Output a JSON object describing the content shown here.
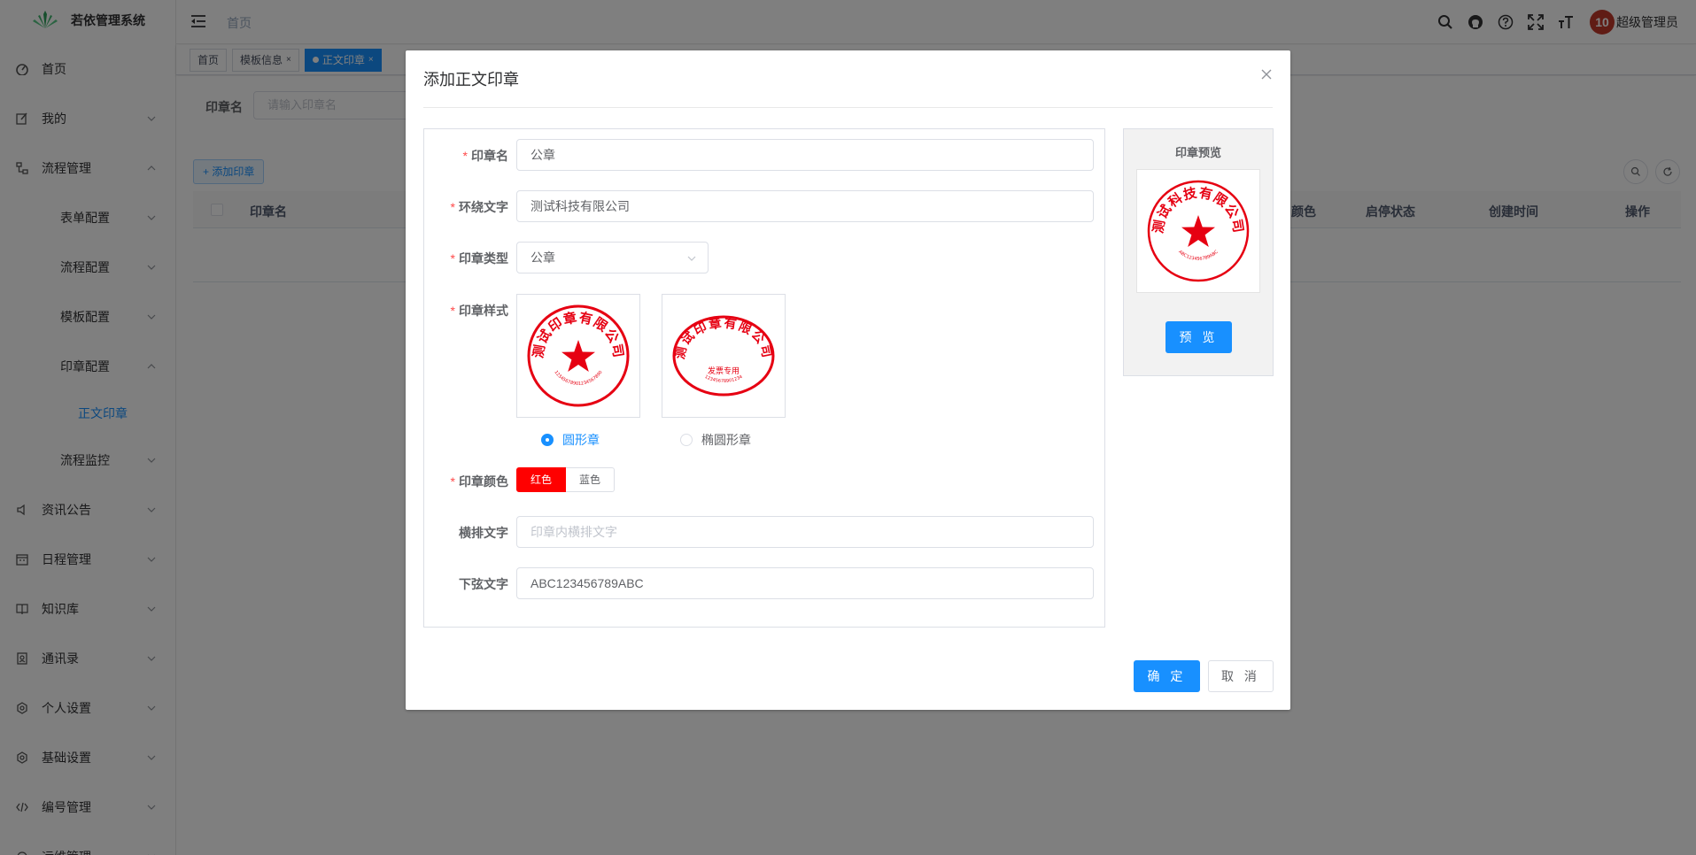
{
  "app": {
    "title": "若依管理系统"
  },
  "sidebar": {
    "items": [
      {
        "label": "首页",
        "icon": "dashboard-icon"
      },
      {
        "label": "我的",
        "icon": "edit-icon"
      },
      {
        "label": "流程管理",
        "icon": "flow-icon"
      },
      {
        "label": "表单配置"
      },
      {
        "label": "流程配置"
      },
      {
        "label": "模板配置"
      },
      {
        "label": "印章配置"
      },
      {
        "label": "正文印章"
      },
      {
        "label": "流程监控"
      },
      {
        "label": "资讯公告",
        "icon": "sound-icon"
      },
      {
        "label": "日程管理",
        "icon": "calendar-icon"
      },
      {
        "label": "知识库",
        "icon": "book-icon"
      },
      {
        "label": "通讯录",
        "icon": "contacts-icon"
      },
      {
        "label": "个人设置",
        "icon": "settings-icon"
      },
      {
        "label": "基础设置",
        "icon": "settings-icon"
      },
      {
        "label": "编号管理",
        "icon": "code-icon"
      },
      {
        "label": "运维管理",
        "icon": "tool-icon"
      }
    ]
  },
  "navbar": {
    "breadcrumb": "首页",
    "avatar_text": "10",
    "username": "超级管理员"
  },
  "tags": [
    {
      "label": "首页"
    },
    {
      "label": "模板信息"
    },
    {
      "label": "正文印章"
    }
  ],
  "page": {
    "search_label": "印章名",
    "search_placeholder": "请输入印章名",
    "add_button": "添加印章",
    "columns": [
      "印章名",
      "颜色",
      "启停状态",
      "创建时间",
      "操作"
    ]
  },
  "dialog": {
    "title": "添加正文印章",
    "fields": {
      "name": {
        "label": "印章名",
        "value": "公章"
      },
      "surround": {
        "label": "环绕文字",
        "value": "测试科技有限公司"
      },
      "type": {
        "label": "印章类型",
        "value": "公章"
      },
      "style": {
        "label": "印章样式"
      },
      "color": {
        "label": "印章颜色"
      },
      "horizontal": {
        "label": "横排文字",
        "placeholder": "印章内横排文字"
      },
      "bottom": {
        "label": "下弦文字",
        "value": "ABC123456789ABC"
      }
    },
    "styles": [
      {
        "label": "圆形章",
        "checked": true,
        "image_text": "测试印章有限公司",
        "image_number": "12345678901234567890"
      },
      {
        "label": "椭圆形章",
        "checked": false,
        "image_text": "测试印章有限公司",
        "image_inner": "发票专用",
        "image_number": "12345678901234"
      }
    ],
    "colors": [
      "红色",
      "蓝色"
    ],
    "selected_color": "红色",
    "preview": {
      "title": "印章预览",
      "button": "预 览",
      "seal_text": "测试科技有限公司",
      "seal_bottom": "ABC123456789ABC"
    },
    "ok": "确 定",
    "cancel": "取 消"
  },
  "theme": {
    "primary": "#1890ff",
    "seal_red": "#ff0000",
    "overlay": "rgba(0,0,0,0.5)"
  }
}
